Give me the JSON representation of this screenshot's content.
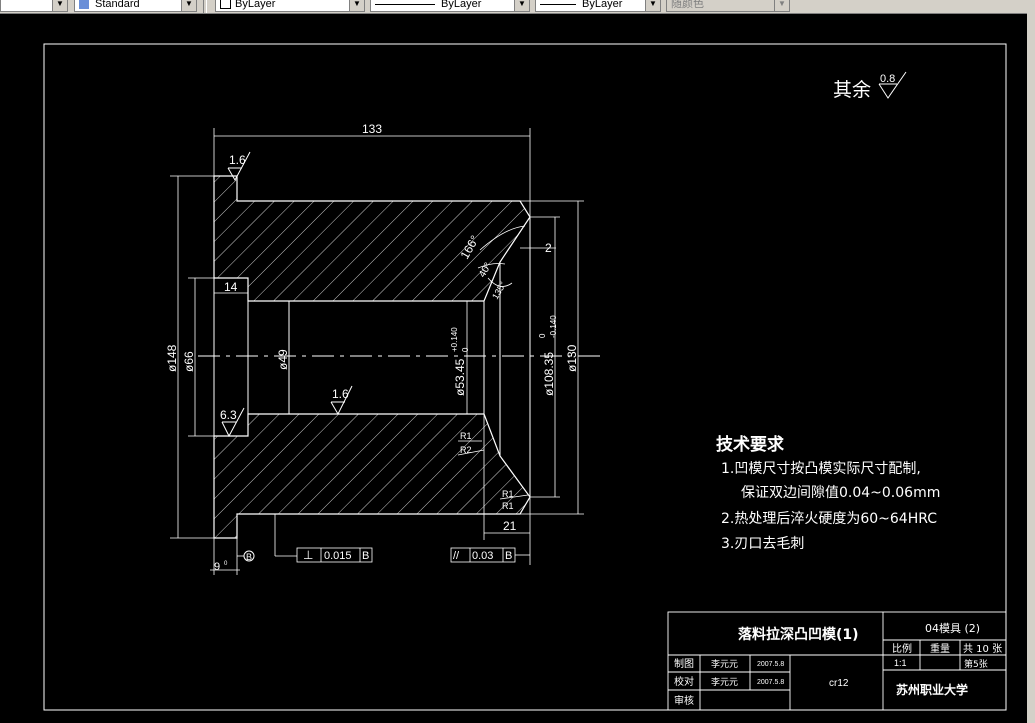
{
  "toolbar": {
    "text_style": "Standard",
    "layer": "ByLayer",
    "linetype": "ByLayer",
    "lineweight": "ByLayer",
    "plot_style": "随颜色"
  },
  "drawing": {
    "surface_finish_note": "其余",
    "surface_finish_value": "0.8",
    "dimensions": {
      "overall_length": "133",
      "roughness_top": "1.6",
      "roughness_bore": "1.6",
      "roughness_left": "6.3",
      "bore_depth": "14",
      "chamfer_len": "2",
      "angle_top": "166°",
      "angle_mid": "40°",
      "angle_low": "135°",
      "dia_148": "ø148",
      "dia_66": "ø66",
      "dia_49": "ø49",
      "dia_53": "ø53.45",
      "dia_53_tol_up": "+0.140",
      "dia_53_tol_low": "0",
      "dia_108": "ø108.35",
      "dia_108_tol_up": "0",
      "dia_108_tol_low": "-0.140",
      "dia_130": "ø130",
      "len_21": "21",
      "r1a": "R1",
      "r2": "R2",
      "r1b": "R1",
      "r1c": "R1",
      "flange": "9",
      "flange_tol": "0\n-0.1",
      "datum": "B"
    },
    "gdt": [
      {
        "symbol": "⊥",
        "value": "0.015",
        "datum": "B"
      },
      {
        "symbol": "//",
        "value": "0.03",
        "datum": "B"
      }
    ]
  },
  "tech_requirements": {
    "title": "技术要求",
    "items": [
      "1.凹模尺寸按凸模实际尺寸配制,",
      "保证双边间隙值0.04~0.06mm",
      "2.热处理后淬火硬度为60~64HRC",
      "3.刃口去毛刺"
    ]
  },
  "title_block": {
    "part_name": "落料拉深凸凹模(1)",
    "drawing_no": "04模具 (2)",
    "scale_label": "比例",
    "weight_label": "重量",
    "sheets_total": "共 10 张",
    "scale_value": "1:1",
    "sheet_no": "第5张",
    "drawn_label": "制图",
    "drawn_name": "李元元",
    "drawn_date": "2007.5.8",
    "checked_label": "校对",
    "checked_name": "李元元",
    "checked_date": "2007.5.8",
    "review_label": "审核",
    "material": "cr12",
    "school": "苏州职业大学"
  },
  "colors": {
    "background": "#000000",
    "lines": "#ffffff",
    "toolbar": "#d4d0c8"
  }
}
